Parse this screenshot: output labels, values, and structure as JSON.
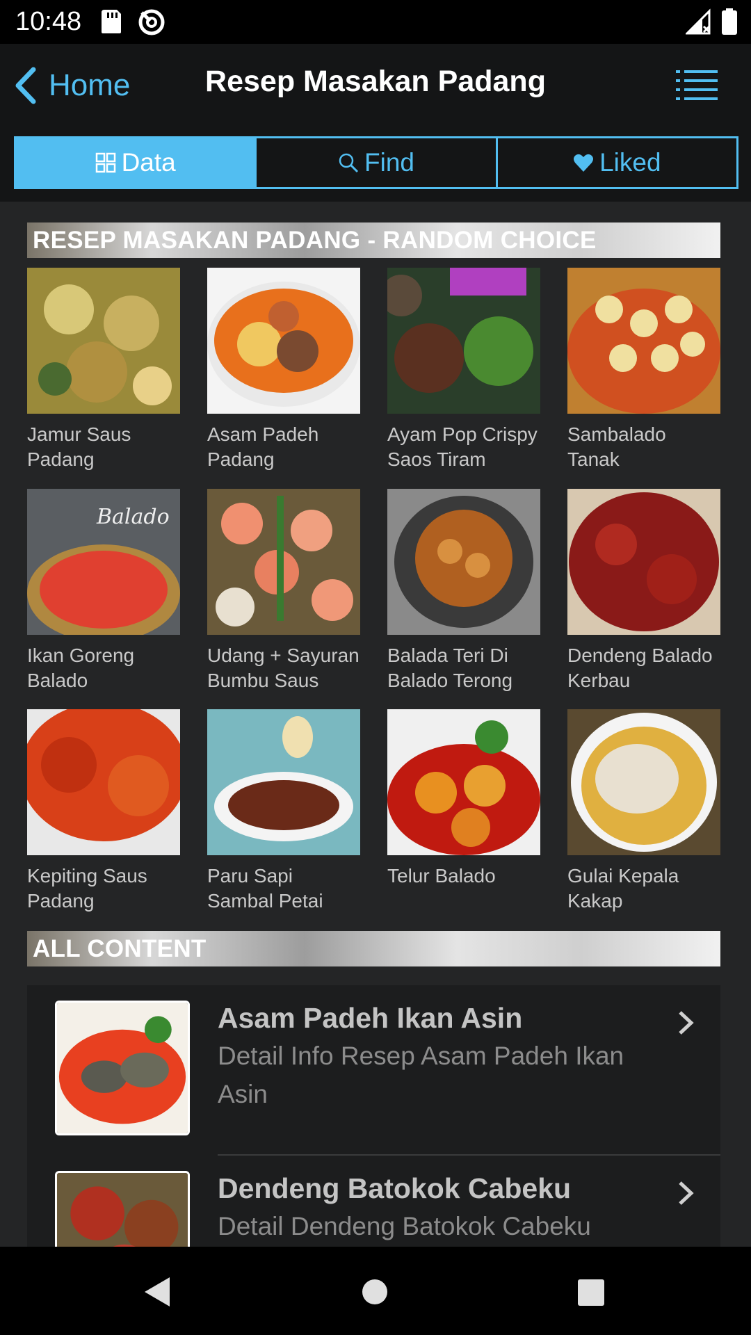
{
  "status_bar": {
    "time": "10:48",
    "icons": [
      "sd-card-icon",
      "sync-icon",
      "signal-icon",
      "battery-icon"
    ]
  },
  "nav": {
    "back_label": "Home",
    "title": "Resep Masakan Padang",
    "menu_icon": "list-menu-icon"
  },
  "tabs": [
    {
      "label": "Data",
      "icon": "grid-icon",
      "active": true
    },
    {
      "label": "Find",
      "icon": "search-icon",
      "active": false
    },
    {
      "label": "Liked",
      "icon": "heart-icon",
      "active": false
    }
  ],
  "random_section": {
    "header": "RESEP MASAKAN PADANG - RANDOM CHOICE",
    "items": [
      {
        "label": "Jamur Saus Padang"
      },
      {
        "label": "Asam Padeh Padang"
      },
      {
        "label": "Ayam Pop Crispy Saos Tiram"
      },
      {
        "label": "Sambalado Tanak"
      },
      {
        "label": "Ikan Goreng Balado"
      },
      {
        "label": "Udang + Sayuran Bumbu Saus"
      },
      {
        "label": "Balada Teri Di Balado Terong"
      },
      {
        "label": "Dendeng Balado Kerbau"
      },
      {
        "label": "Kepiting Saus Padang"
      },
      {
        "label": "Paru Sapi Sambal Petai"
      },
      {
        "label": "Telur Balado"
      },
      {
        "label": "Gulai Kepala Kakap"
      }
    ]
  },
  "all_content": {
    "header": "ALL CONTENT",
    "items": [
      {
        "title": "Asam Padeh Ikan Asin",
        "subtitle": "Detail Info Resep Asam Padeh Ikan Asin"
      },
      {
        "title": "Dendeng Batokok Cabeku",
        "subtitle": "Detail Dendeng Batokok Cabeku"
      }
    ]
  },
  "colors": {
    "accent": "#52bef1",
    "background": "#242526",
    "nav_background": "#141516"
  }
}
